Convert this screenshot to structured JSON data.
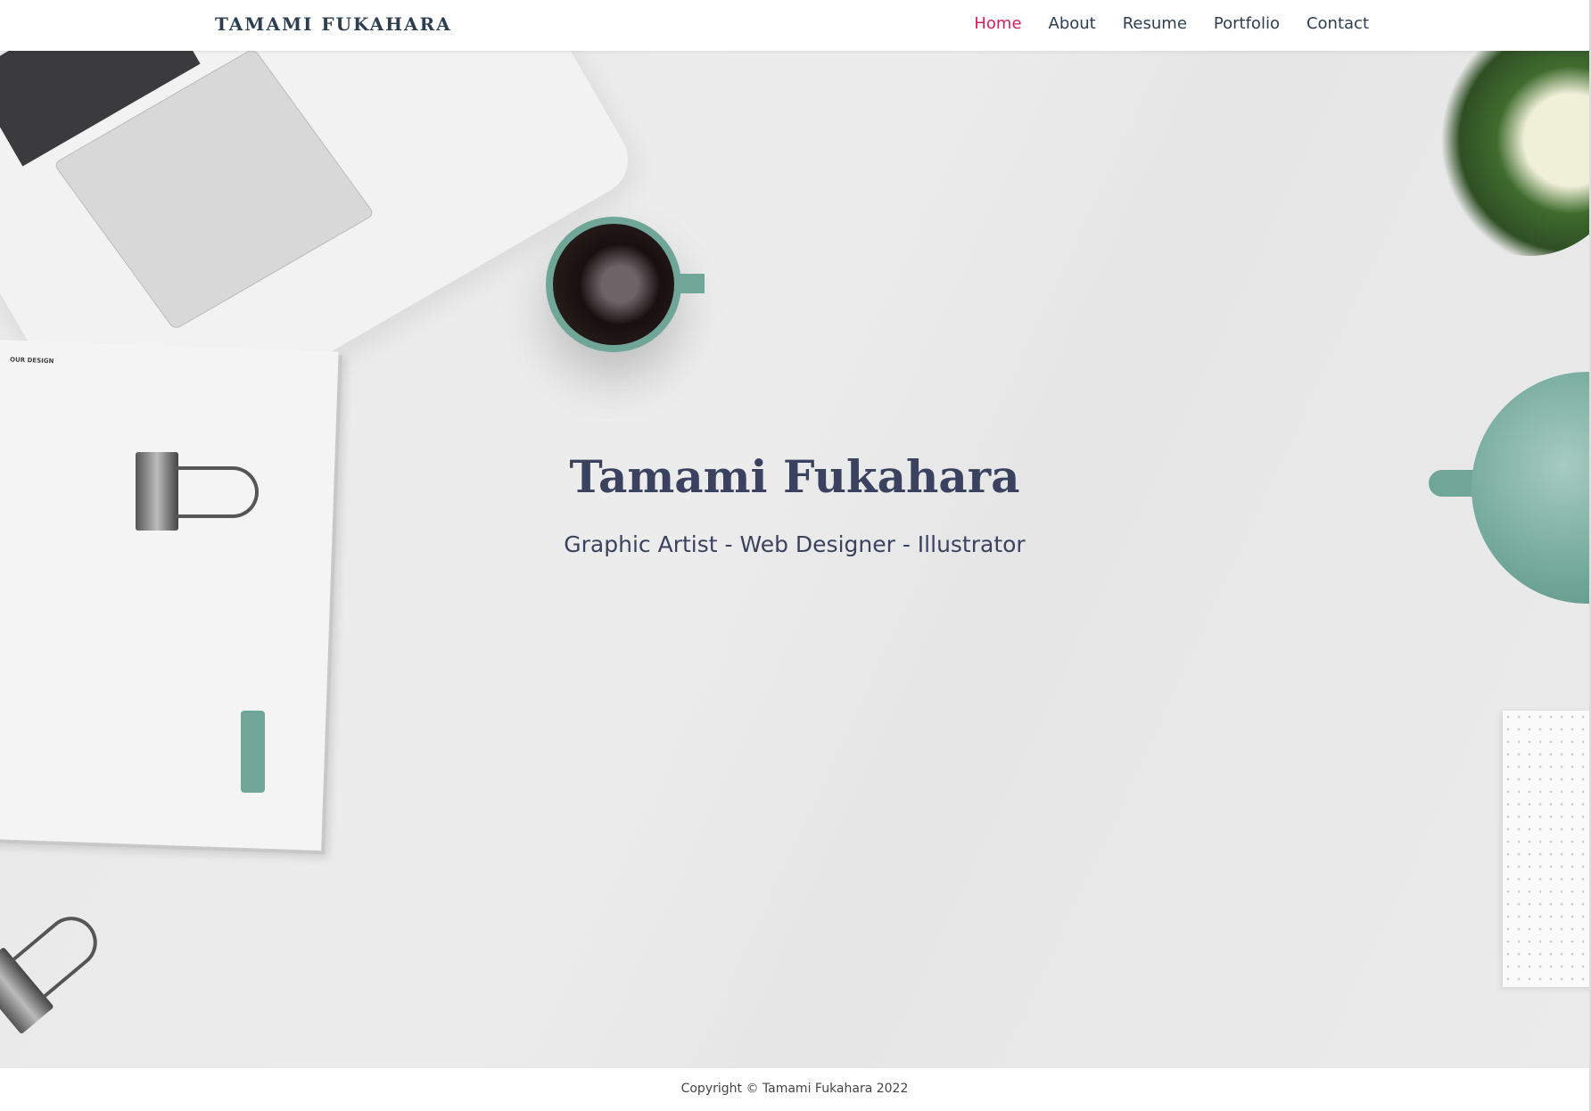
{
  "nav": {
    "logo": "TAMAMI FUKAHARA",
    "items": [
      {
        "label": "Home",
        "active": true
      },
      {
        "label": "About"
      },
      {
        "label": "Resume"
      },
      {
        "label": "Portfolio"
      },
      {
        "label": "Contact"
      }
    ]
  },
  "hero": {
    "title": "Tamami Fukahara",
    "subtitle": "Graphic Artist - Web Designer - Illustrator",
    "paper_label": "OUR DESIGN"
  },
  "footer": {
    "copyright": "Copyright © Tamami Fukahara 2022"
  },
  "colors": {
    "accent": "#d41f59",
    "text": "#2c3e50",
    "heading": "#3b4260"
  }
}
